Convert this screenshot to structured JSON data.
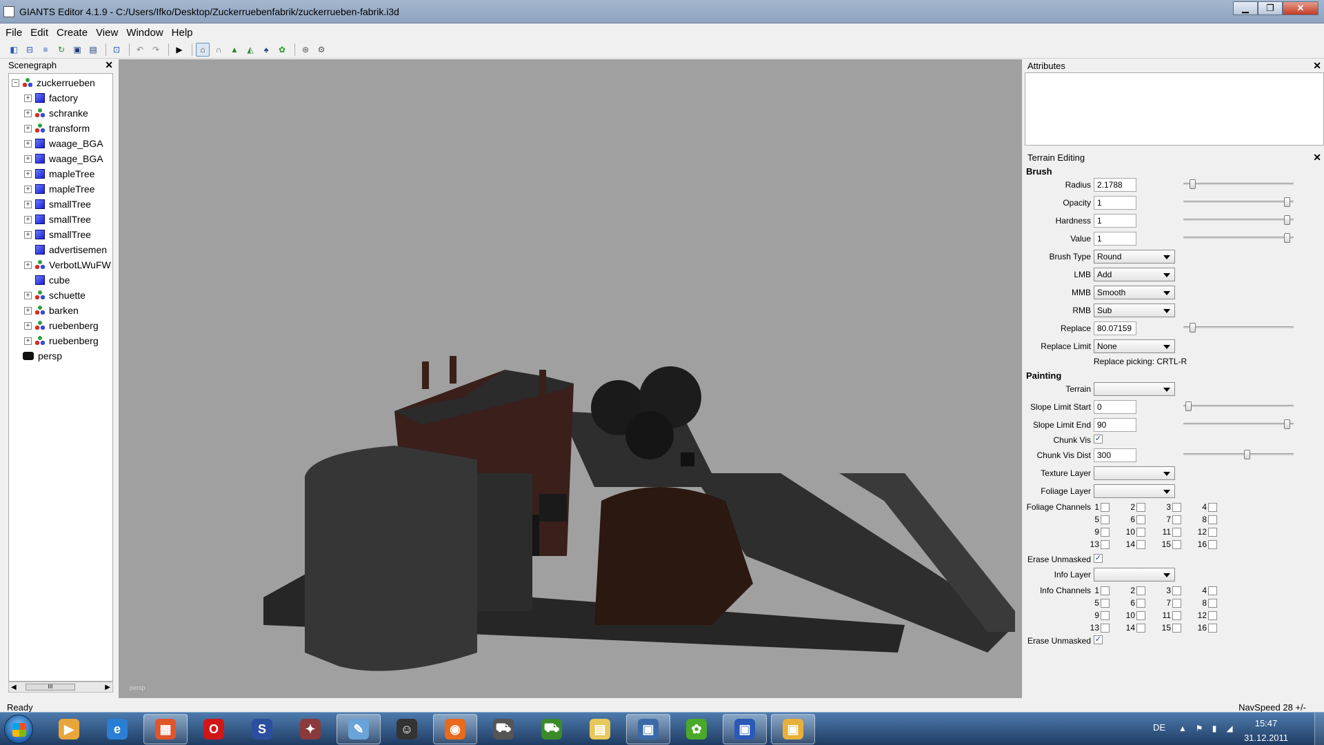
{
  "window": {
    "title": "GIANTS Editor 4.1.9 - C:/Users/Ifko/Desktop/Zuckerruebenfabrik/zuckerrueben-fabrik.i3d"
  },
  "menu": [
    "File",
    "Edit",
    "Create",
    "View",
    "Window",
    "Help"
  ],
  "toolbar": {
    "buttons": [
      "new-icon",
      "open-icon",
      "import-icon",
      "reload-icon",
      "save-icon",
      "save-as-icon",
      "select-icon",
      "undo-icon",
      "redo-icon",
      "play-icon",
      "select-mode-icon",
      "move-mode-icon",
      "terrain-sculpt-icon",
      "terrain-paint-icon",
      "terrain-foliage-icon",
      "foliage-icon",
      "snap-icon",
      "settings-icon"
    ]
  },
  "scenegraph": {
    "title": "Scenegraph",
    "items": [
      {
        "label": "zuckerrueben",
        "icon": "transform",
        "level": 0,
        "expander": "−"
      },
      {
        "label": "factory",
        "icon": "shape",
        "level": 1,
        "expander": "+"
      },
      {
        "label": "schranke",
        "icon": "transform",
        "level": 1,
        "expander": "+"
      },
      {
        "label": "transform",
        "icon": "transform",
        "level": 1,
        "expander": "+"
      },
      {
        "label": "waage_BGA",
        "icon": "shape",
        "level": 1,
        "expander": "+"
      },
      {
        "label": "waage_BGA",
        "icon": "shape",
        "level": 1,
        "expander": "+"
      },
      {
        "label": "mapleTree",
        "icon": "shape",
        "level": 1,
        "expander": "+"
      },
      {
        "label": "mapleTree",
        "icon": "shape",
        "level": 1,
        "expander": "+"
      },
      {
        "label": "smallTree",
        "icon": "shape",
        "level": 1,
        "expander": "+"
      },
      {
        "label": "smallTree",
        "icon": "shape",
        "level": 1,
        "expander": "+"
      },
      {
        "label": "smallTree",
        "icon": "shape",
        "level": 1,
        "expander": "+"
      },
      {
        "label": "advertisemen",
        "icon": "shape",
        "level": 1,
        "expander": ""
      },
      {
        "label": "VerbotLWuFW",
        "icon": "transform",
        "level": 1,
        "expander": "+"
      },
      {
        "label": "cube",
        "icon": "shape",
        "level": 1,
        "expander": ""
      },
      {
        "label": "schuette",
        "icon": "transform",
        "level": 1,
        "expander": "+"
      },
      {
        "label": "barken",
        "icon": "transform",
        "level": 1,
        "expander": "+"
      },
      {
        "label": "ruebenberg",
        "icon": "transform",
        "level": 1,
        "expander": "+"
      },
      {
        "label": "ruebenberg",
        "icon": "transform",
        "level": 1,
        "expander": "+"
      },
      {
        "label": "persp",
        "icon": "camera",
        "level": 0,
        "expander": ""
      }
    ],
    "scroll_thumb": "III"
  },
  "viewport": {
    "camera_label": "persp",
    "background": "#a0a0a0"
  },
  "attributes": {
    "title": "Attributes"
  },
  "terrain_editing": {
    "title": "Terrain Editing",
    "brush_section": "Brush",
    "radius": {
      "label": "Radius",
      "value": "2.1788",
      "slider": 0.06
    },
    "opacity": {
      "label": "Opacity",
      "value": "1",
      "slider": 0.97
    },
    "hardness": {
      "label": "Hardness",
      "value": "1",
      "slider": 0.97
    },
    "value": {
      "label": "Value",
      "value": "1",
      "slider": 0.97
    },
    "brush_type": {
      "label": "Brush Type",
      "value": "Round"
    },
    "lmb": {
      "label": "LMB",
      "value": "Add"
    },
    "mmb": {
      "label": "MMB",
      "value": "Smooth"
    },
    "rmb": {
      "label": "RMB",
      "value": "Sub"
    },
    "replace": {
      "label": "Replace",
      "value": "80.07159",
      "slider": 0.06
    },
    "replace_limit": {
      "label": "Replace Limit",
      "value": "None"
    },
    "replace_picking": "Replace picking: CRTL-R",
    "painting_section": "Painting",
    "terrain": {
      "label": "Terrain",
      "value": ""
    },
    "slope_limit_start": {
      "label": "Slope Limit Start",
      "value": "0",
      "slider": 0.02
    },
    "slope_limit_end": {
      "label": "Slope Limit End",
      "value": "90",
      "slider": 0.97
    },
    "chunk_vis": {
      "label": "Chunk Vis",
      "checked": true
    },
    "chunk_vis_dist": {
      "label": "Chunk Vis Dist",
      "value": "300",
      "slider": 0.58
    },
    "texture_layer": {
      "label": "Texture Layer",
      "value": ""
    },
    "foliage_layer": {
      "label": "Foliage Layer",
      "value": ""
    },
    "foliage_channels": {
      "label": "Foliage Channels",
      "numbers": [
        "1",
        "2",
        "3",
        "4",
        "5",
        "6",
        "7",
        "8",
        "9",
        "10",
        "11",
        "12",
        "13",
        "14",
        "15",
        "16"
      ]
    },
    "erase_unmasked_1": {
      "label": "Erase Unmasked",
      "checked": true
    },
    "info_layer": {
      "label": "Info Layer",
      "value": ""
    },
    "info_channels": {
      "label": "Info Channels",
      "numbers": [
        "1",
        "2",
        "3",
        "4",
        "5",
        "6",
        "7",
        "8",
        "9",
        "10",
        "11",
        "12",
        "13",
        "14",
        "15",
        "16"
      ]
    },
    "erase_unmasked_2": {
      "label": "Erase Unmasked",
      "checked": true
    }
  },
  "status": {
    "ready": "Ready",
    "navspeed": "NavSpeed 28 +/-"
  },
  "taskbar": {
    "apps": [
      {
        "name": "media-player-icon",
        "color": "#e8a63a",
        "glyph": "▶"
      },
      {
        "name": "internet-explorer-icon",
        "color": "#2a7fd4",
        "glyph": "e"
      },
      {
        "name": "image-viewer-icon",
        "color": "#e0552b",
        "glyph": "▦",
        "active": true
      },
      {
        "name": "opera-icon",
        "color": "#d01616",
        "glyph": "O"
      },
      {
        "name": "app-s-icon",
        "color": "#2b4f9e",
        "glyph": "S"
      },
      {
        "name": "farm-game-icon",
        "color": "#8a3a3a",
        "glyph": "✦"
      },
      {
        "name": "paint-icon",
        "color": "#6aa3d8",
        "glyph": "✎",
        "active": true
      },
      {
        "name": "user-app-icon",
        "color": "#333333",
        "glyph": "☺"
      },
      {
        "name": "firefox-icon",
        "color": "#e86a1a",
        "glyph": "◉",
        "active": true
      },
      {
        "name": "tractor-icon",
        "color": "#555555",
        "glyph": "⛟"
      },
      {
        "name": "tractor-green-icon",
        "color": "#3a8a2a",
        "glyph": "⛟"
      },
      {
        "name": "explorer-icon",
        "color": "#e8c85a",
        "glyph": "▤"
      },
      {
        "name": "giants-editor-icon",
        "color": "#3a6aa8",
        "glyph": "▣",
        "active": true
      },
      {
        "name": "icq-icon",
        "color": "#4aa82a",
        "glyph": "✿"
      },
      {
        "name": "app-blue-icon",
        "color": "#2a5ab8",
        "glyph": "▣",
        "active": true
      },
      {
        "name": "app-yellow-icon",
        "color": "#e8b03a",
        "glyph": "▣",
        "active": true
      }
    ],
    "language": "DE",
    "time": "15:47",
    "date": "31.12.2011"
  }
}
